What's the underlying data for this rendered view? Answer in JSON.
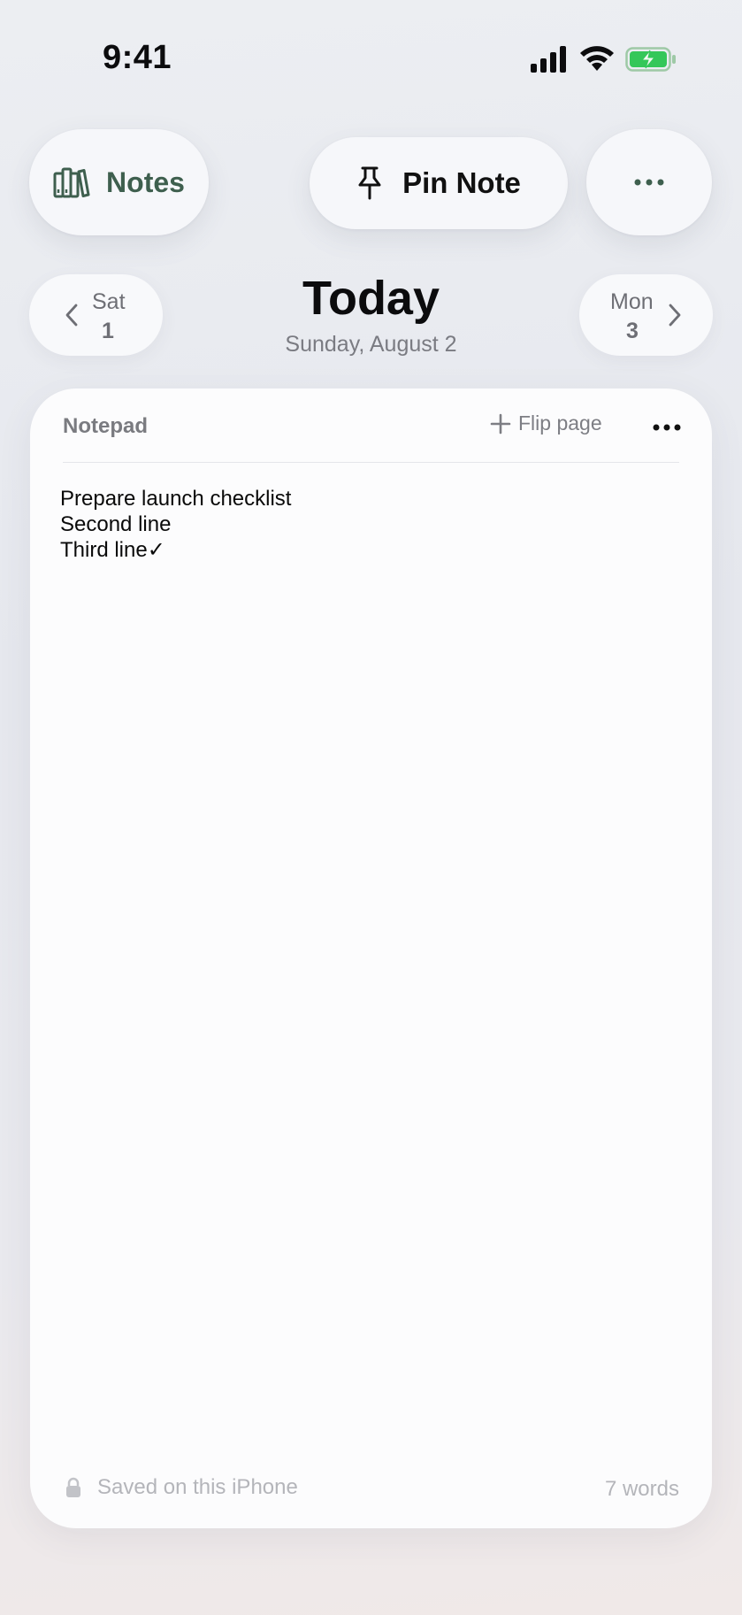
{
  "status_bar": {
    "time": "9:41"
  },
  "header": {
    "notes_label": "Notes",
    "pin_label": "Pin Note"
  },
  "date_nav": {
    "prev": {
      "day": "Sat",
      "num": "1"
    },
    "title": "Today",
    "subtitle": "Sunday, August 2",
    "next": {
      "day": "Mon",
      "num": "3"
    }
  },
  "card": {
    "title": "Notepad",
    "flip_label": "Flip page",
    "lines": [
      "Prepare launch checklist",
      "Second line",
      "Third line✓"
    ],
    "saved_label": "Saved on this iPhone",
    "word_count": "7 words"
  },
  "colors": {
    "accent_green": "#3e5f4e",
    "battery_green": "#34c759",
    "muted_text": "#7a7b82"
  },
  "icons": [
    "signal-icon",
    "wifi-icon",
    "battery-charging-icon",
    "library-icon",
    "pin-icon",
    "more-icon",
    "chevron-left-icon",
    "chevron-right-icon",
    "plus-icon",
    "lock-icon"
  ]
}
